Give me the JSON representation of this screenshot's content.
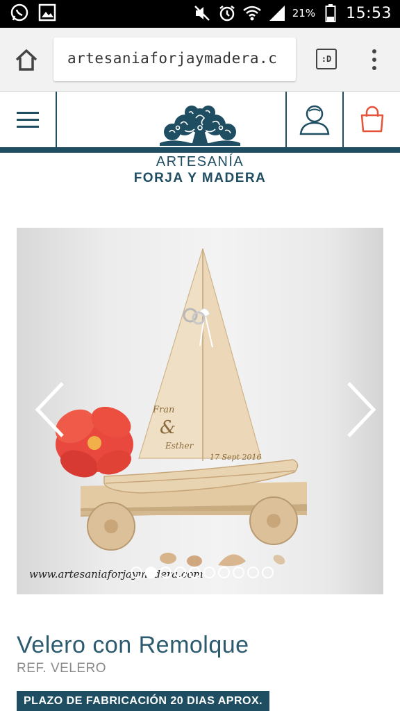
{
  "status_bar": {
    "time": "15:53",
    "battery_percent": "21%",
    "icons": [
      "whatsapp-icon",
      "gallery-icon",
      "mute-icon",
      "alarm-icon",
      "wifi-icon",
      "signal-icon",
      "battery-icon"
    ]
  },
  "browser": {
    "url": "artesaniaforjaymadera.c",
    "tabs_label": ":D",
    "icons": [
      "home-icon",
      "tabs-icon",
      "overflow-menu-icon"
    ]
  },
  "site_header": {
    "brand_line1": "ARTESANÍA",
    "brand_line2": "FORJA Y MADERA",
    "icons": [
      "hamburger-menu-icon",
      "user-account-icon",
      "shopping-bag-icon"
    ]
  },
  "gallery": {
    "watermark": "www.artesaniaforjaymadera.com",
    "sail_names": [
      "Fran",
      "&",
      "Esther"
    ],
    "sail_date": "17 Sept 2016",
    "slide_count": 10,
    "active_slide": 1,
    "icons": [
      "chevron-left-icon",
      "chevron-right-icon"
    ]
  },
  "product": {
    "title": "Velero con Remolque",
    "reference": "REF. VELERO",
    "lead_time": "PLAZO DE FABRICACIÓN 20 DIAS APROX."
  },
  "colors": {
    "brand": "#1f4e62",
    "title": "#2c5a6f",
    "cart_accent": "#e5533a",
    "muted_text": "#8a8a8a"
  }
}
